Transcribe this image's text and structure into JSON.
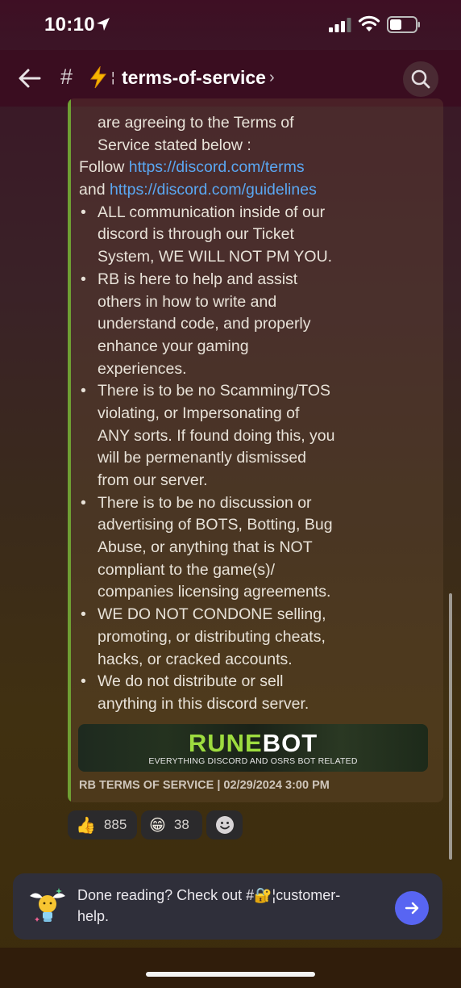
{
  "status_bar": {
    "time": "10:10"
  },
  "header": {
    "channel_prefix": "#",
    "channel_separator": "¦",
    "channel_name": "terms-of-service",
    "chevron": "›",
    "icons": [
      "back-arrow-icon",
      "hash-icon",
      "lightning-bolt-icon",
      "search-icon"
    ]
  },
  "embed": {
    "accent_color": "#6f9f33",
    "lines": {
      "l0": "are agreeing to the Terms of",
      "l1": "Service stated below :",
      "l2_prefix": "Follow ",
      "l2_link": "https://discord.com/terms",
      "l3_prefix": "and ",
      "l3_link": "https://discord.com/guidelines",
      "b1_1": "ALL communication inside of our",
      "b1_2": "discord is through our Ticket",
      "b1_3": "System, WE WILL NOT PM YOU.",
      "b2_1": "RB is here to help and assist",
      "b2_2": "others in how to write and",
      "b2_3": "understand code, and properly",
      "b2_4": "enhance your gaming",
      "b2_5": "experiences.",
      "b3_1": "There is to be no Scamming/TOS",
      "b3_2": "violating, or Impersonating of",
      "b3_3": "ANY sorts. If found doing this, you",
      "b3_4": "will be permenantly dismissed",
      "b3_5": "from our server.",
      "b4_1": "There is to be no discussion or",
      "b4_2": "advertising of BOTS, Botting, Bug",
      "b4_3": "Abuse, or anything that is NOT",
      "b4_4": "compliant to the game(s)/",
      "b4_5": "companies licensing agreements.",
      "b5_1": "WE DO NOT CONDONE selling,",
      "b5_2": "promoting, or distributing cheats,",
      "b5_3": "hacks, or cracked accounts.",
      "b6_1": "We do not distribute or sell",
      "b6_2": "anything in this discord server."
    },
    "banner": {
      "title_part1": "RUNE",
      "title_part2": "BOT",
      "subtitle": "EVERYTHING DISCORD AND OSRS BOT RELATED"
    },
    "footer": "RB TERMS OF SERVICE | 02/29/2024 3:00 PM"
  },
  "reactions": [
    {
      "emoji": "👍",
      "count": "885"
    },
    {
      "emoji": "😁",
      "count": "38"
    },
    {
      "emoji": "add-reaction-icon",
      "count": ""
    }
  ],
  "cta": {
    "line1": "Done reading? Check out #🔐¦customer-",
    "line2": "help.",
    "icons": [
      "lightbulb-mascot-icon",
      "arrow-right-icon"
    ]
  },
  "colors": {
    "link": "#5aa7f2",
    "header_bg": "#3a0d20",
    "send_button": "#5865f2",
    "banner_accent": "#9ddc3f"
  }
}
